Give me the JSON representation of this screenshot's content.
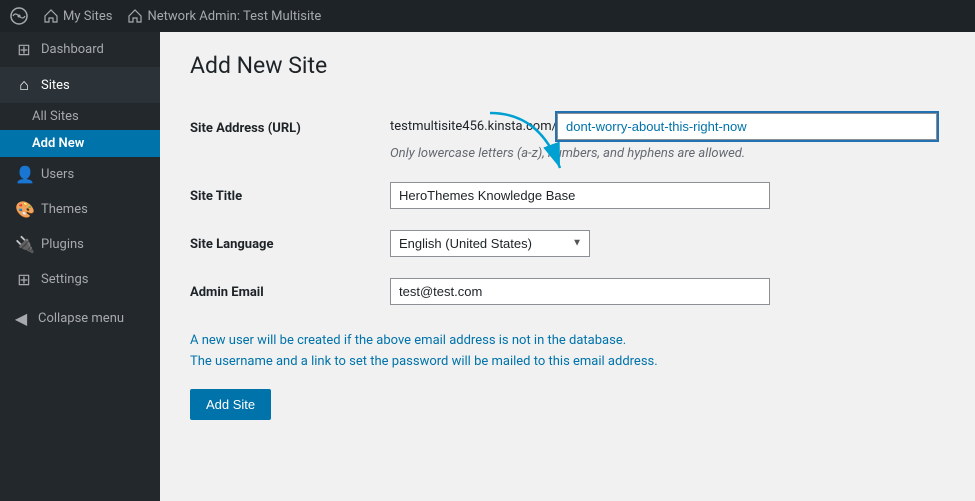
{
  "topbar": {
    "wp_icon": "⊕",
    "my_sites_label": "My Sites",
    "network_admin_label": "Network Admin: Test Multisite"
  },
  "sidebar": {
    "dashboard_label": "Dashboard",
    "sites_label": "Sites",
    "all_sites_label": "All Sites",
    "add_new_label": "Add New",
    "users_label": "Users",
    "themes_label": "Themes",
    "plugins_label": "Plugins",
    "settings_label": "Settings",
    "collapse_label": "Collapse menu"
  },
  "page": {
    "title": "Add New Site",
    "site_address_label": "Site Address (URL)",
    "url_prefix": "testmultisite456.kinsta.com/",
    "url_suffix_value": "dont-worry-about-this-right-now",
    "url_hint": "Only lowercase letters (a-z), numbers, and hyphens are allowed.",
    "site_title_label": "Site Title",
    "site_title_value": "HeroThemes Knowledge Base",
    "site_language_label": "Site Language",
    "site_language_value": "English (United States)",
    "admin_email_label": "Admin Email",
    "admin_email_value": "test@test.com",
    "info_line1": "A new user will be created if the above email address is not in the database.",
    "info_line2": "The username and a link to set the password will be mailed to this email address.",
    "add_site_btn": "Add Site"
  }
}
